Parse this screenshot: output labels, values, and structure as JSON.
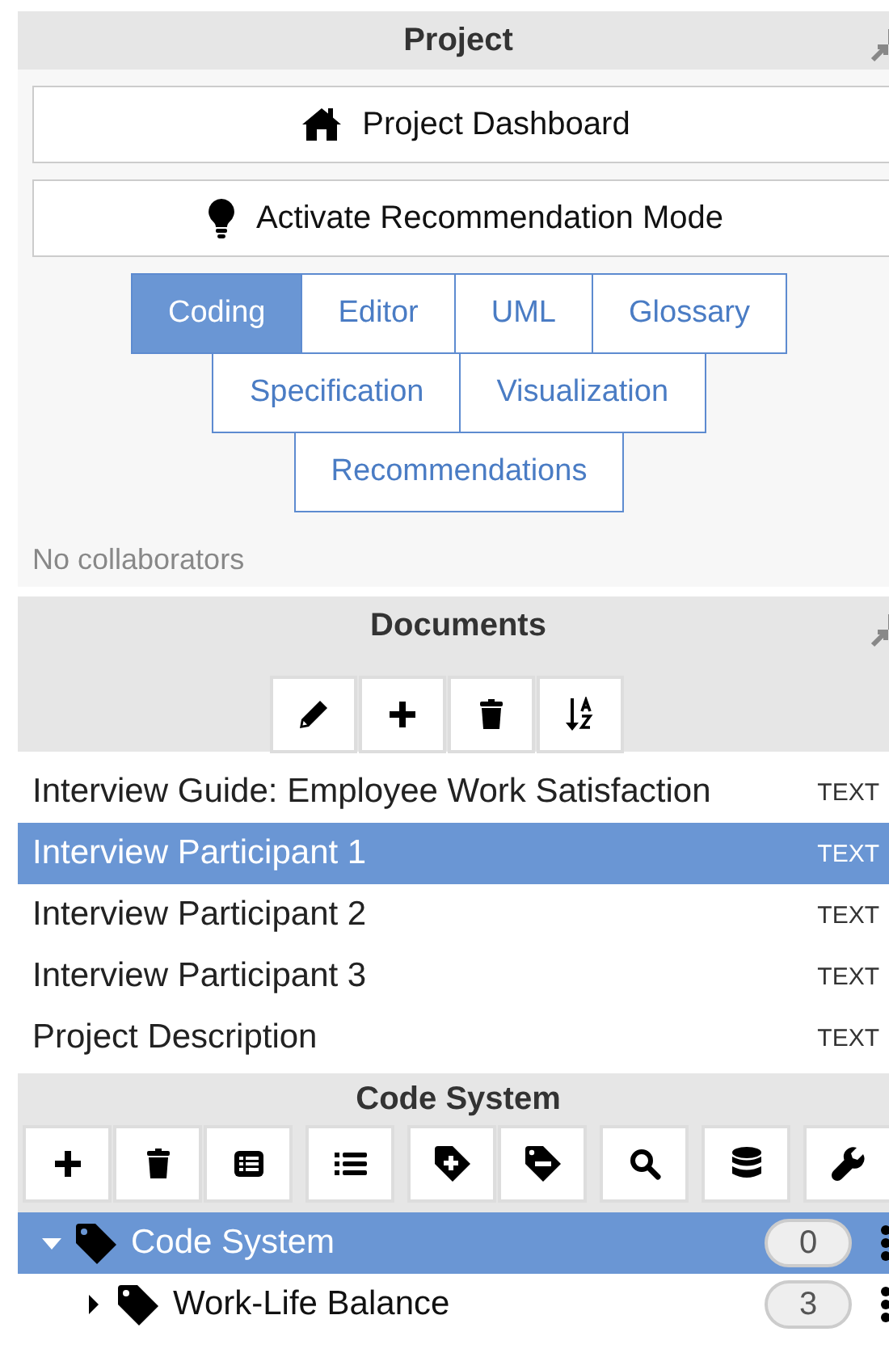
{
  "project": {
    "title": "Project",
    "actions": [
      {
        "kind": "home",
        "label": "Project Dashboard"
      },
      {
        "kind": "bulb",
        "label": "Activate Recommendation Mode"
      }
    ],
    "tab_rows": [
      [
        {
          "label": "Coding",
          "selected": true
        },
        {
          "label": "Editor",
          "selected": false
        },
        {
          "label": "UML",
          "selected": false
        },
        {
          "label": "Glossary",
          "selected": false
        }
      ],
      [
        {
          "label": "Specification",
          "selected": false
        },
        {
          "label": "Visualization",
          "selected": false
        }
      ],
      [
        {
          "label": "Recommendations",
          "selected": false
        }
      ]
    ],
    "collaborators": "No collaborators"
  },
  "documents": {
    "title": "Documents",
    "tools": [
      {
        "kind": "pencil"
      },
      {
        "kind": "plus"
      },
      {
        "kind": "trash"
      },
      {
        "kind": "sort"
      }
    ],
    "rows": [
      {
        "name": "Interview Guide: Employee Work Satisfaction",
        "type": "TEXT",
        "selected": false
      },
      {
        "name": "Interview Participant 1",
        "type": "TEXT",
        "selected": true
      },
      {
        "name": "Interview Participant 2",
        "type": "TEXT",
        "selected": false
      },
      {
        "name": "Interview Participant 3",
        "type": "TEXT",
        "selected": false
      },
      {
        "name": "Project Description",
        "type": "TEXT",
        "selected": false
      }
    ]
  },
  "code_system": {
    "title": "Code System",
    "tools": [
      {
        "kind": "plus"
      },
      {
        "kind": "trash"
      },
      {
        "kind": "listbox"
      },
      {
        "kind": "list"
      },
      {
        "kind": "tagplus"
      },
      {
        "kind": "tagminus"
      },
      {
        "kind": "search"
      },
      {
        "kind": "database"
      },
      {
        "kind": "wrench"
      }
    ],
    "tree": [
      {
        "name": "Code System",
        "count": "0",
        "selected": true,
        "expanded": true,
        "children": [
          {
            "name": "Work-Life Balance",
            "count": "3",
            "selected": false,
            "expanded": false
          }
        ]
      }
    ]
  }
}
